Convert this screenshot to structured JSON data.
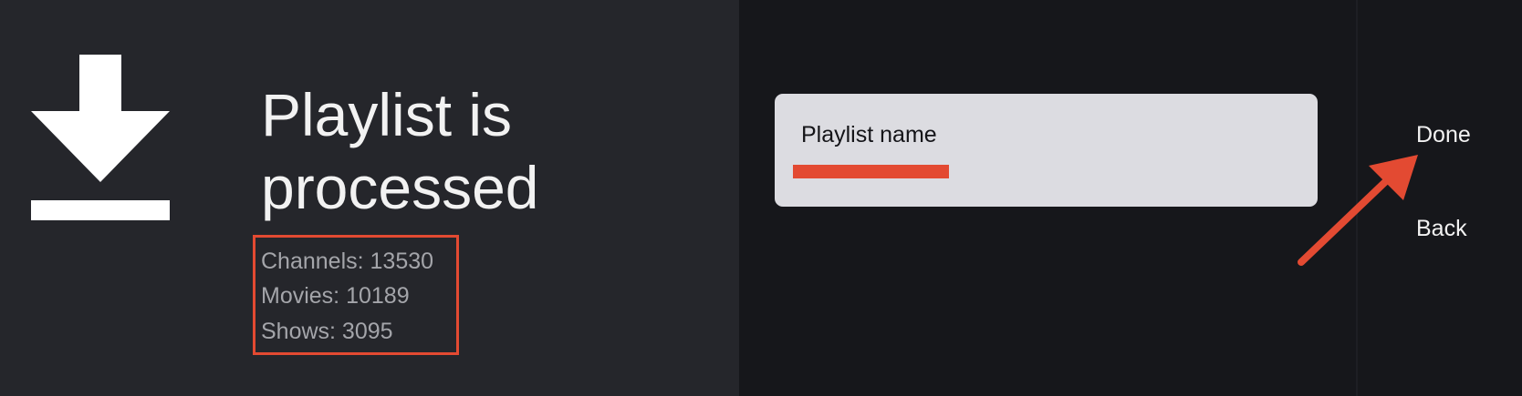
{
  "title": "Playlist is processed",
  "icons": {
    "main": "download-icon",
    "annotation": "arrow-icon"
  },
  "stats": {
    "channels": "Channels: 13530",
    "movies": "Movies: 10189",
    "shows": "Shows: 3095"
  },
  "playlist_field": {
    "label": "Playlist name"
  },
  "actions": {
    "done": "Done",
    "back": "Back"
  },
  "colors": {
    "background_left": "#25262b",
    "background_right": "#16171b",
    "card": "#dcdce1",
    "annotation": "#e34a32",
    "text_primary": "#f2f2f2",
    "text_secondary": "#a4a5aa"
  }
}
